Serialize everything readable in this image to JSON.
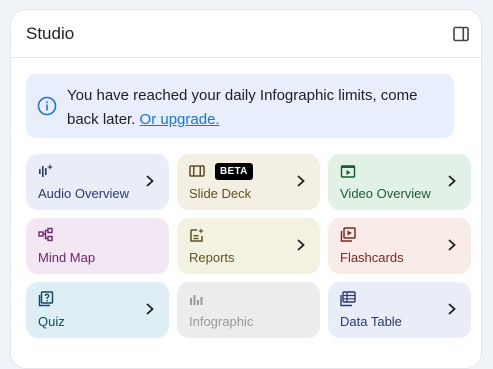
{
  "panel": {
    "title": "Studio",
    "toggle_icon": "side-panel-icon"
  },
  "notice": {
    "icon": "info-icon",
    "text": "You have reached your daily Infographic limits, come back later. ",
    "link_label": "Or upgrade."
  },
  "tiles": [
    {
      "label": "Audio Overview",
      "icon": "audio-waveform-icon",
      "bg": "#e9edf8",
      "fg": "#2b3a6a",
      "chevron": true
    },
    {
      "label": "Slide Deck",
      "icon": "slides-icon",
      "bg": "#f3efe2",
      "fg": "#5f4f22",
      "badge": "BETA",
      "chevron": true
    },
    {
      "label": "Video Overview",
      "icon": "video-icon",
      "bg": "#e1f1e5",
      "fg": "#1f5a34",
      "chevron": true
    },
    {
      "label": "Mind Map",
      "icon": "mind-map-icon",
      "bg": "#f2e7f2",
      "fg": "#6a2a6a",
      "chevron": false
    },
    {
      "label": "Reports",
      "icon": "reports-icon",
      "bg": "#f3f1e2",
      "fg": "#5c5220",
      "chevron": true
    },
    {
      "label": "Flashcards",
      "icon": "flashcards-icon",
      "bg": "#f8ebe8",
      "fg": "#7a2a22",
      "chevron": true
    },
    {
      "label": "Quiz",
      "icon": "quiz-icon",
      "bg": "#ddeff5",
      "fg": "#104b60",
      "chevron": true
    },
    {
      "label": "Infographic",
      "icon": "infographic-icon",
      "bg": "#ececec",
      "fg": "#9a9a9a",
      "chevron": false
    },
    {
      "label": "Data Table",
      "icon": "data-table-icon",
      "bg": "#e9edf8",
      "fg": "#2b3a6a",
      "chevron": true
    }
  ]
}
